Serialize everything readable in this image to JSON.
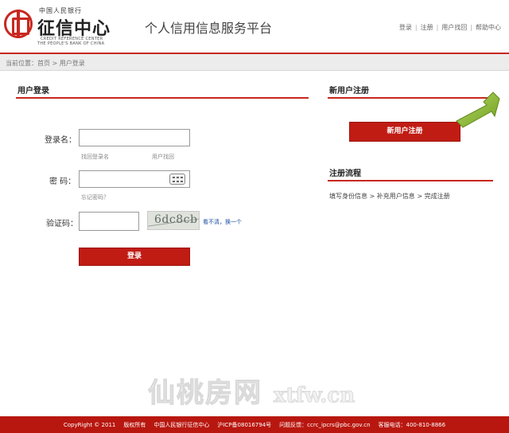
{
  "header": {
    "logo": {
      "top_text": "中国人民银行",
      "main_text": "征信中心",
      "en_line1": "CREDIT REFERENCE CENTER",
      "en_line2": "THE PEOPLE'S BANK OF CHINA"
    },
    "site_title": "个人信用信息服务平台",
    "links": [
      "登录",
      "注册",
      "用户找回",
      "帮助中心"
    ]
  },
  "breadcrumb": "当前位置：首页 > 用户登录",
  "login": {
    "title": "用户登录",
    "username_label": "登录名：",
    "username_value": "",
    "find_username": "找回登录名",
    "find_username_2": "用户找回",
    "password_label": "密  码：",
    "password_value": "",
    "forgot_password": "忘记密码？",
    "captcha_label": "验证码：",
    "captcha_value": "",
    "captcha_text": "6dc8cb",
    "refresh_text": "看不清，换一个",
    "login_button": "登录"
  },
  "register": {
    "title": "新用户注册",
    "button": "新用户注册",
    "process_title": "注册流程",
    "steps": "填写身份信息 > 补充用户信息 > 完成注册"
  },
  "watermark": {
    "cn": "仙桃房网",
    "domain": "xtfw.cn"
  },
  "footer": {
    "copyright": "CopyRight © 2011",
    "rights": "版权所有",
    "org": "中国人民银行征信中心",
    "icp": "沪ICP备08016794号",
    "feedback": "问题反馈：ccrc_ipcrs@pbc.gov.cn",
    "phone": "客服电话：400-810-8866"
  },
  "colors": {
    "accent": "#c8281f",
    "footer": "#b8170f",
    "button": "#c01c14",
    "arrow": "#8dbb2c"
  }
}
